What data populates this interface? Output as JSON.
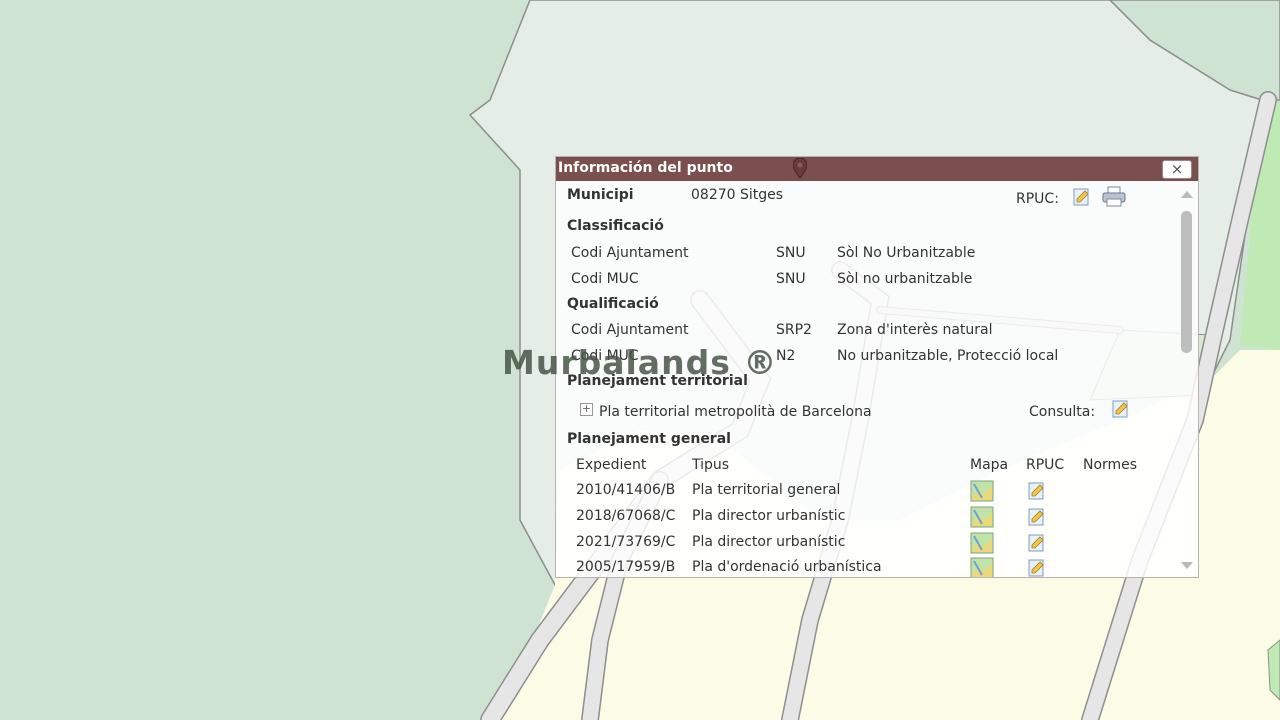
{
  "popup": {
    "title": "Información del punto",
    "close_label": "×",
    "municipi_label": "Municipi",
    "municipi_value": "08270 Sitges",
    "rpuc_label": "RPUC:",
    "classificacio": {
      "heading": "Classificació",
      "rows": [
        {
          "label": "Codi Ajuntament",
          "code": "SNU",
          "desc": "Sòl No Urbanitzable"
        },
        {
          "label": "Codi MUC",
          "code": "SNU",
          "desc": "Sòl no urbanitzable"
        }
      ]
    },
    "qualificacio": {
      "heading": "Qualificació",
      "rows": [
        {
          "label": "Codi Ajuntament",
          "code": "SRP2",
          "desc": "Zona d'interès natural"
        },
        {
          "label": "Codi MUC",
          "code": "N2",
          "desc": "No urbanitzable, Protecció local"
        }
      ]
    },
    "planejament_territorial": {
      "heading": "Planejament territorial",
      "expand_symbol": "+",
      "item": "Pla territorial metropolità de Barcelona",
      "consulta_label": "Consulta:"
    },
    "planejament_general": {
      "heading": "Planejament general",
      "columns": [
        "Expedient",
        "Tipus",
        "Mapa",
        "RPUC",
        "Normes"
      ],
      "rows": [
        {
          "expedient": "2010/41406/B",
          "tipus": "Pla territorial general"
        },
        {
          "expedient": "2018/67068/C",
          "tipus": "Pla director urbanístic"
        },
        {
          "expedient": "2021/73769/C",
          "tipus": "Pla director urbanístic"
        },
        {
          "expedient": "2005/17959/B",
          "tipus": "Pla d'ordenació urbanística"
        }
      ]
    }
  },
  "watermark": "Murbalands ®",
  "colors": {
    "header": "#7b4f4e",
    "map_green": "#cfe3d2",
    "map_light": "#e4ede6",
    "map_yellow": "#fbfbe6",
    "road": "#e6e6e6",
    "road_edge": "#8e8e8e"
  }
}
